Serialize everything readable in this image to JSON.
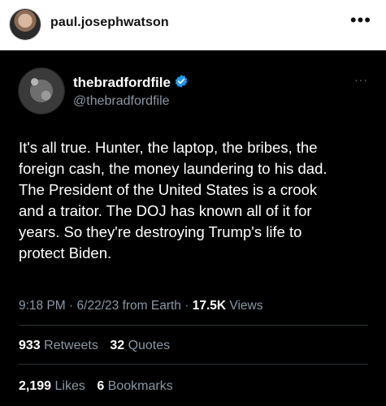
{
  "instagram": {
    "username": "paul.josephwatson",
    "more_icon": "•••"
  },
  "tweet": {
    "display_name": "thebradfordfile",
    "handle": "@thebradfordfile",
    "more_icon": "···",
    "verified": true,
    "verified_color": "#1d9bf0",
    "text_lines": [
      "It's all true. Hunter, the laptop, the bribes, the",
      "foreign cash, the money laundering to his dad.",
      "The President of the United States is a crook",
      "and a traitor. The DOJ has known all of it for",
      "years. So they're destroying Trump's life to",
      "protect Biden."
    ],
    "time": "9:18 PM",
    "date": "6/22/23",
    "source": "from Earth",
    "views_count": "17.5K",
    "views_label": "Views",
    "retweets_count": "933",
    "retweets_label": "Retweets",
    "quotes_count": "32",
    "quotes_label": "Quotes",
    "likes_count": "2,199",
    "likes_label": "Likes",
    "bookmarks_count": "6",
    "bookmarks_label": "Bookmarks"
  }
}
